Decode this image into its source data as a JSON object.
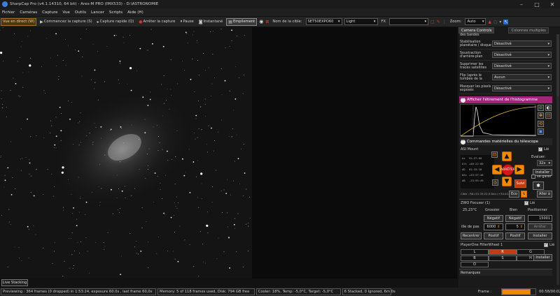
{
  "window": {
    "title": "SharpCap Pro (v4.1.14310, 64 bit) - Ares-M PRO (IMX533) - D:\\ASTRONOMIE"
  },
  "menu": [
    "Fichier",
    "Caméras",
    "Capture",
    "Vue",
    "Outils",
    "Lancer",
    "Scripts",
    "Aide (H)"
  ],
  "toolbar": {
    "live_view": "Vue en direct (W)",
    "start_capture": "Commencez la capture (S)",
    "quick_capture": "Capture rapide (Q)",
    "stop_capture": "Arrêter la capture",
    "pause": "Pause",
    "snapshot": "Instantané",
    "stacking": "Empilement",
    "target_label": "Nom de la cible:",
    "target_value": "SET50EXPO60",
    "frame_type": "Light",
    "fx_label": "FX",
    "fx_value": "",
    "zoom_label": "Zoom:",
    "zoom_value": "Auto"
  },
  "panel": {
    "tab_controls": "Camera Controls",
    "tab_multi": "Colonnes multiples",
    "cut_label": "des bandes",
    "settings": [
      {
        "label": "Stabilisation planétaire / disque",
        "value": "Désactivé"
      },
      {
        "label": "Soustraction d'arrière-plan",
        "value": "Désactivé"
      },
      {
        "label": "Supprimer les traces satellites",
        "value": "Désactivé"
      },
      {
        "label": "Flip (après le tombée de la",
        "value": "Aucun"
      },
      {
        "label": "Masquer les pixels exposés",
        "value": "Désactivé"
      }
    ],
    "histogram_title": "Afficher l'étirement de l'histogramme",
    "telescope_title": "Commandes matérielles du télescope",
    "mount": {
      "name": "ASI Mount",
      "linked": "Lié",
      "evaluate_label": "Evaluer:",
      "evaluate_value": "32x",
      "install": "Installer",
      "stop": "ARRÊTER",
      "follow": "Suivi",
      "park": "Eco",
      "goto": "Aller à",
      "sea_game": "se garer",
      "coords": [
        {
          "k": "Az",
          "v": "91:27:00"
        },
        {
          "k": "Alt",
          "v": "+46:22:00"
        },
        {
          "k": "AD",
          "v": "01:33:18"
        },
        {
          "k": "Déc",
          "v": "+33:57:48"
        },
        {
          "k": "AB",
          "v": "-23:55:49"
        }
      ],
      "target_line": "Cible : RA=01:33:22.0 Dec=+30:41:44"
    },
    "focuser": {
      "name": "ZWO Focuser (1)",
      "linked": "Lié",
      "temp": "25,23°C",
      "coarse": "Grossier",
      "fine": "Bien",
      "position_label": "Positionner",
      "neg1": "Négatif",
      "neg2": "Négatif",
      "position_value": "15001",
      "step_label": "ille de pas",
      "step_coarse": "6000",
      "step_fine": "5",
      "stop": "Arrêter",
      "recenter": "Recentrer",
      "pos1": "Positif",
      "pos2": "Positif",
      "install": "Installer"
    },
    "filterwheel": {
      "name": "PlayerOne FilterWheel 1",
      "linked": "Lié",
      "filters": [
        "L",
        "R",
        "G",
        "B",
        "S",
        "H",
        "O"
      ],
      "selected": "R",
      "install": "Installer"
    },
    "remarks": "Remarques"
  },
  "live_stacking": "Live Stacking",
  "status": {
    "previewing": "Previewing : 364 frames (0 dropped) in 1:53:24, exposure 60.0s , last frame 60,0s",
    "memory": "Memory: 5 of 118 frames used, Disk: 794 GB free",
    "cooler": "Cooler: 18%, Temp: -5,0°C, Target: -5,0°C",
    "stacked": "6 Stacked, 0 Ignored, 6m 0s",
    "frame_label": "Frame :",
    "time": "00:58/00:02",
    "frame_progress": 0.85
  },
  "colors": {
    "accent": "#f08a00",
    "stop": "#d11818",
    "hist_header": "#a0267c",
    "selected_filter": "#c43a12"
  }
}
